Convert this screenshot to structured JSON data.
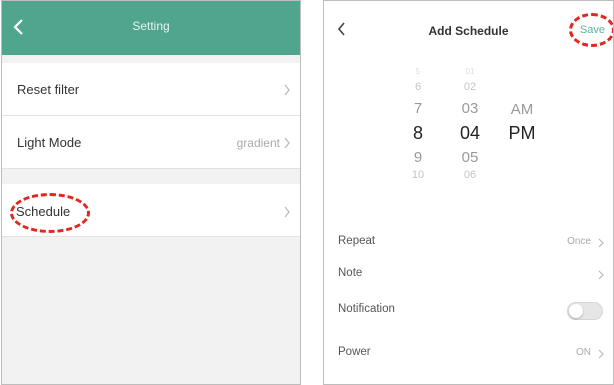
{
  "left_screen": {
    "header": {
      "title": "Setting",
      "back_icon": "chevron-left-icon"
    },
    "rows": {
      "reset_filter": {
        "label": "Reset filter",
        "value": ""
      },
      "light_mode": {
        "label": "Light Mode",
        "value": "gradient"
      },
      "schedule": {
        "label": "Schedule",
        "value": ""
      }
    }
  },
  "right_screen": {
    "header": {
      "title": "Add Schedule",
      "save": "Save",
      "back_icon": "chevron-left-icon"
    },
    "time_picker": {
      "hours": [
        "6",
        "7",
        "8",
        "9",
        "10"
      ],
      "minutes": [
        "02",
        "03",
        "04",
        "05",
        "06"
      ],
      "periods": [
        "AM",
        "PM"
      ],
      "selected": {
        "hour": "8",
        "minute": "04",
        "period": "PM"
      }
    },
    "settings": {
      "repeat": {
        "label": "Repeat",
        "value": "Once"
      },
      "note": {
        "label": "Note",
        "value": ""
      },
      "notification": {
        "label": "Notification",
        "enabled": false
      },
      "power": {
        "label": "Power",
        "value": "ON"
      }
    }
  },
  "colors": {
    "header_teal": "#4fa58d",
    "highlight_red": "#e4261d",
    "save_green": "#58b49a"
  }
}
